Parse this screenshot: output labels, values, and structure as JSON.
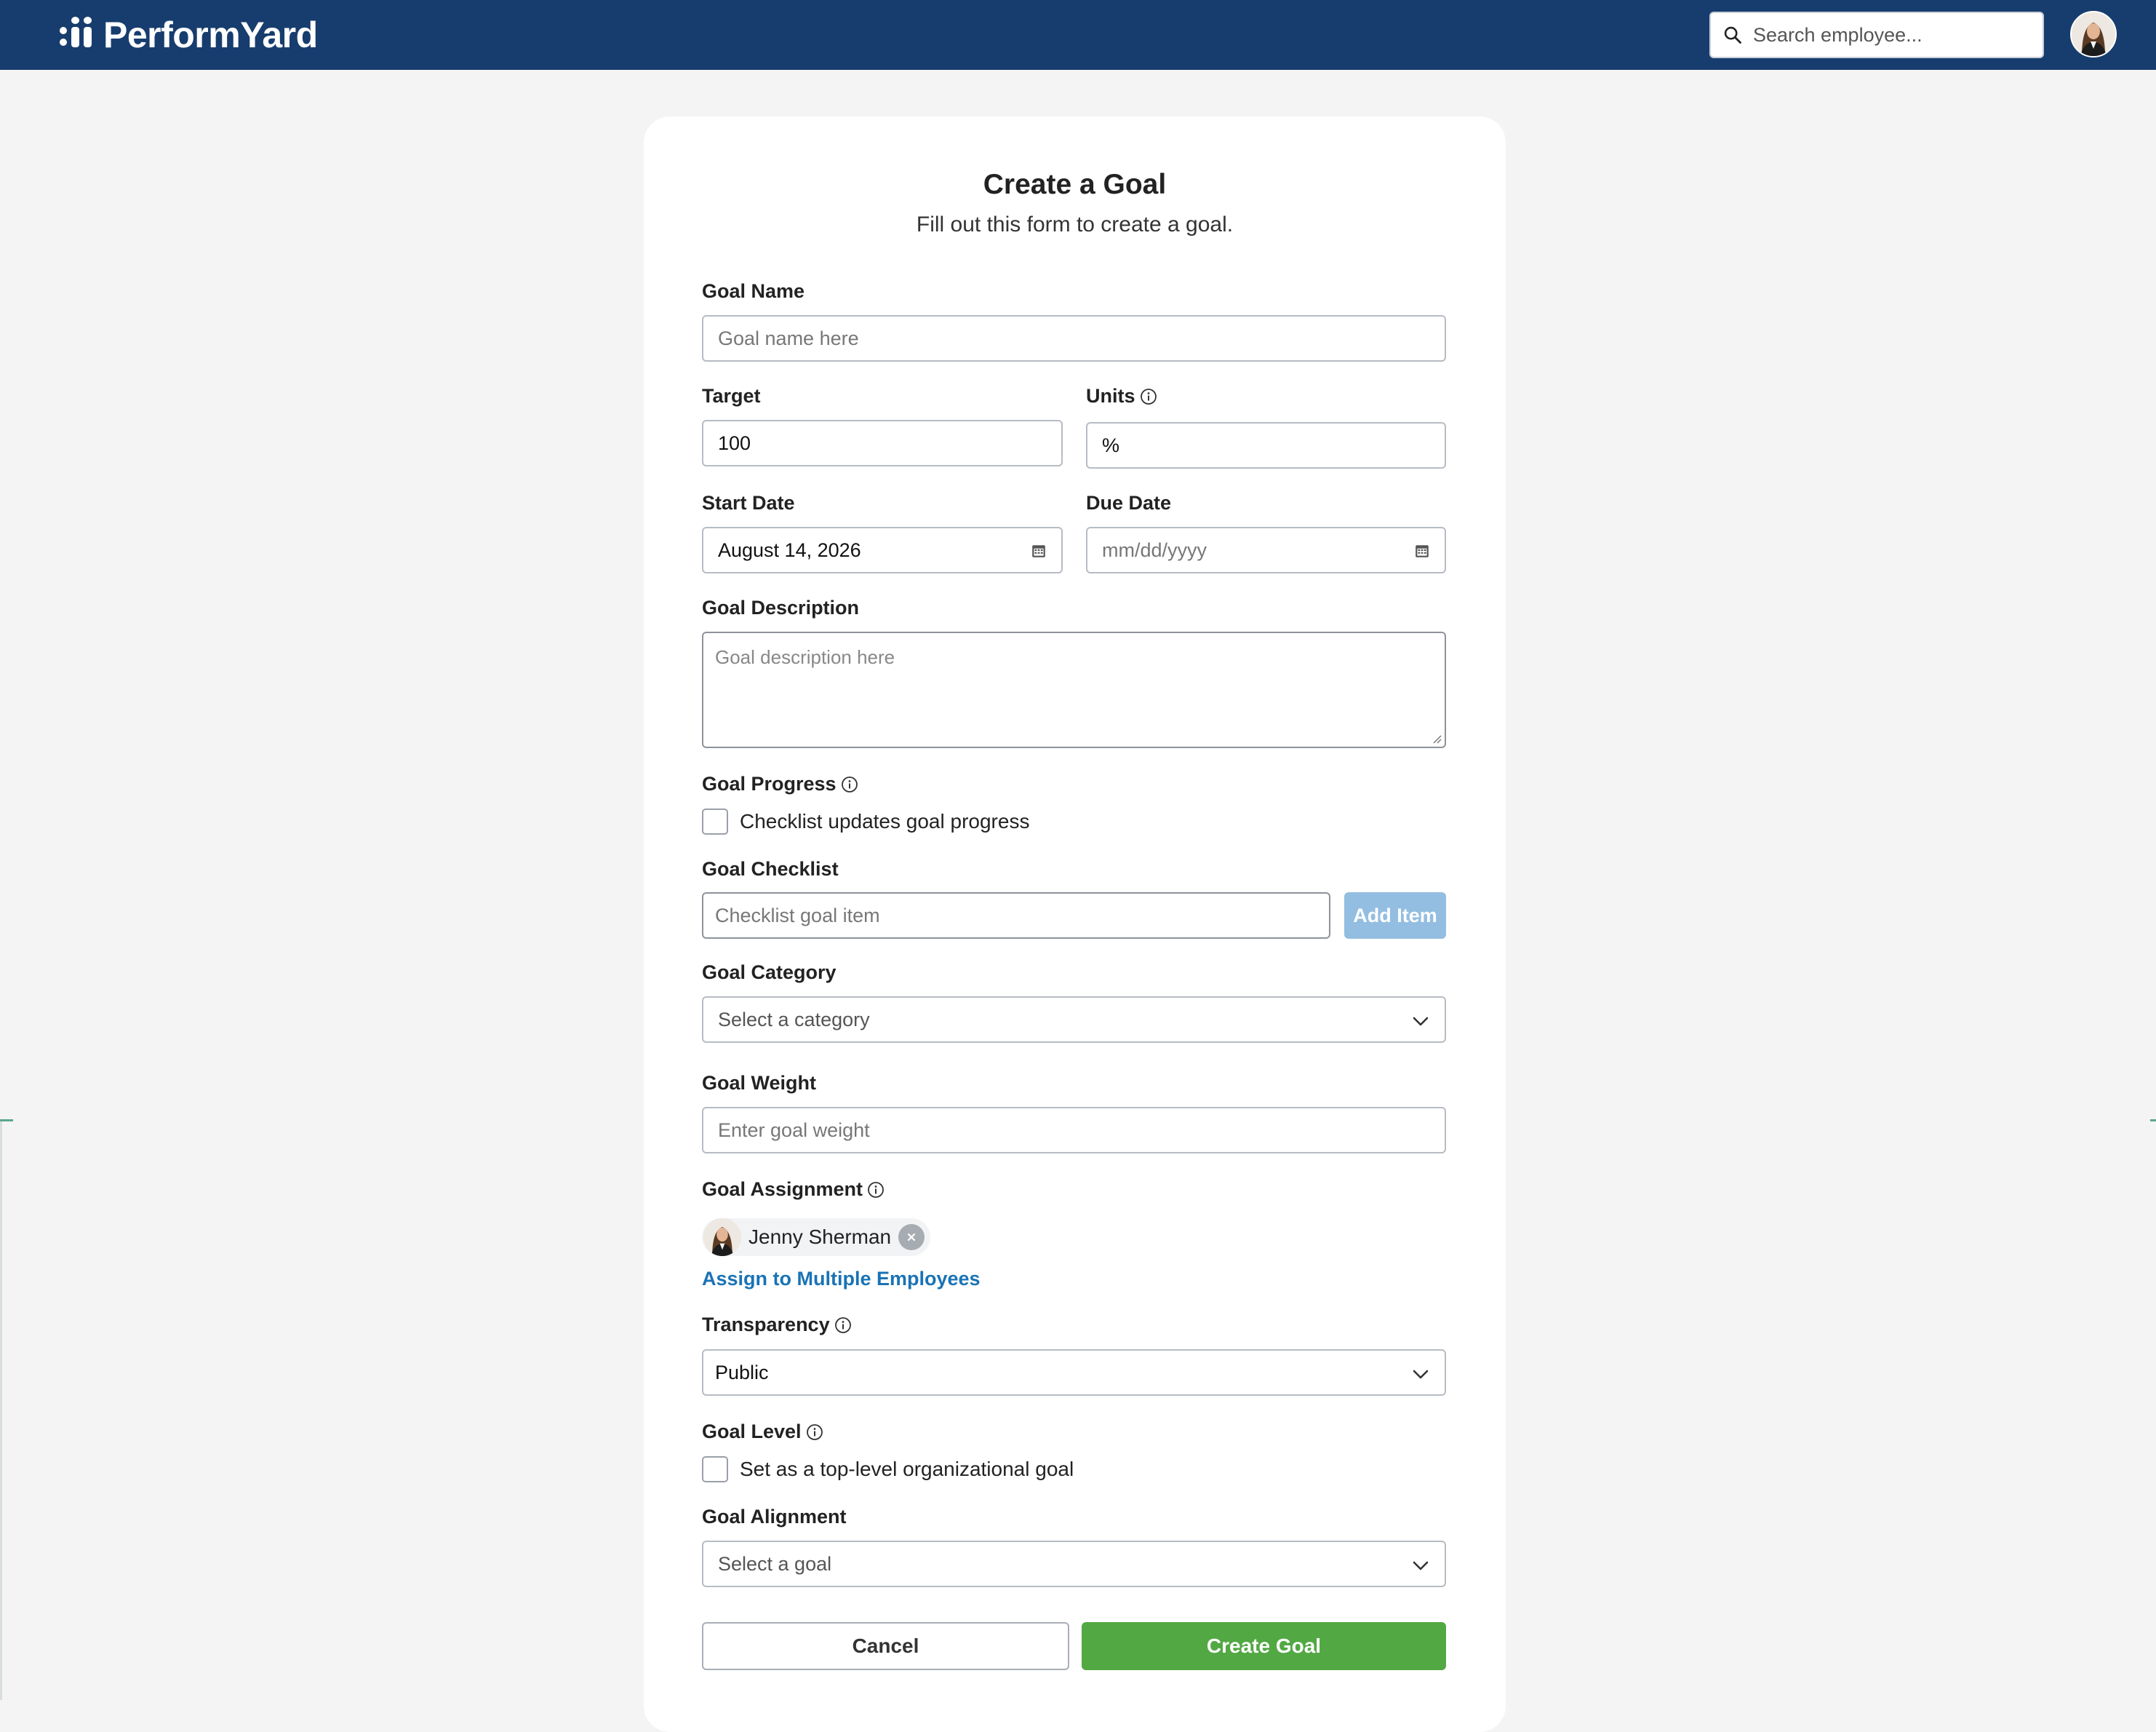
{
  "header": {
    "logo_text": "PerformYard",
    "search_placeholder": "Search employee..."
  },
  "form": {
    "title": "Create a Goal",
    "subtitle": "Fill out this form to create a goal.",
    "goal_name": {
      "label": "Goal Name",
      "placeholder": "Goal name here",
      "value": ""
    },
    "target": {
      "label": "Target",
      "value": "100"
    },
    "units": {
      "label": "Units",
      "value": "%"
    },
    "start_date": {
      "label": "Start Date",
      "value": "August 14, 2026"
    },
    "due_date": {
      "label": "Due Date",
      "placeholder": "mm/dd/yyyy"
    },
    "description": {
      "label": "Goal Description",
      "placeholder": "Goal description here"
    },
    "progress": {
      "label": "Goal Progress",
      "checkbox_label": "Checklist updates goal progress",
      "checked": false
    },
    "checklist": {
      "label": "Goal Checklist",
      "placeholder": "Checklist goal item",
      "add_button": "Add Item"
    },
    "category": {
      "label": "Goal Category",
      "selected": "Select a category"
    },
    "weight": {
      "label": "Goal Weight",
      "placeholder": "Enter goal weight"
    },
    "assignment": {
      "label": "Goal Assignment",
      "assignee": "Jenny Sherman",
      "multi_link": "Assign to Multiple Employees"
    },
    "transparency": {
      "label": "Transparency",
      "selected": "Public"
    },
    "level": {
      "label": "Goal Level",
      "checkbox_label": "Set as a top-level organizational goal",
      "checked": false
    },
    "alignment": {
      "label": "Goal Alignment",
      "selected": "Select a goal"
    },
    "cancel_button": "Cancel",
    "create_button": "Create Goal"
  },
  "colors": {
    "header_bg": "#173d6e",
    "primary_green": "#52a843",
    "link_blue": "#1a73b5",
    "add_button_disabled": "#93bee1"
  },
  "icons": [
    "search-icon",
    "info-icon",
    "calendar-icon",
    "chevron-down-icon",
    "close-icon",
    "avatar"
  ]
}
